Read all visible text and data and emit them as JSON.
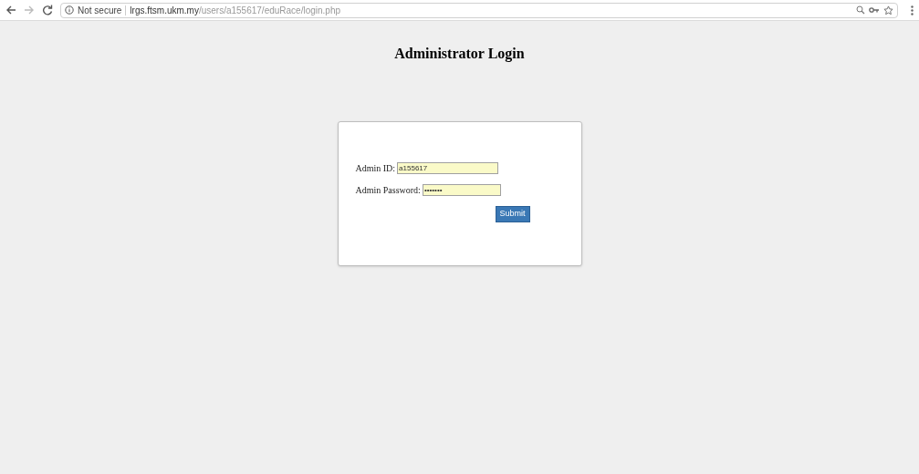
{
  "browser": {
    "security_label": "Not secure",
    "url_host": "lrgs.ftsm.ukm.my",
    "url_path": "/users/a155617/eduRace/login.php"
  },
  "page": {
    "title": "Administrator Login"
  },
  "form": {
    "fields": [
      {
        "label": "Admin ID:",
        "value": "a155617"
      },
      {
        "label": "Admin Password:",
        "value": "•••••••"
      }
    ],
    "submit": "Submit"
  }
}
